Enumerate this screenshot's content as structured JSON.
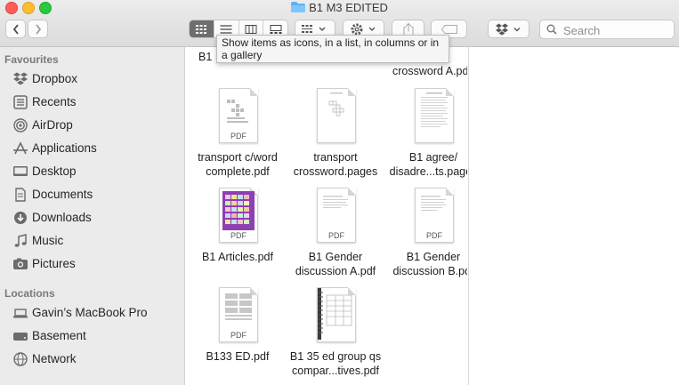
{
  "window": {
    "title": "B1 M3 EDITED",
    "tooltip": "Show items as icons, in a list, in columns or in a gallery"
  },
  "toolbar": {
    "back_icon": "chevron-left-icon",
    "forward_icon": "chevron-right-icon",
    "view_modes": [
      "icons",
      "list",
      "columns",
      "gallery"
    ],
    "selected_view": "icons",
    "search_placeholder": "Search"
  },
  "sidebar": {
    "favourites_heading": "Favourites",
    "favourites": [
      {
        "label": "Dropbox",
        "icon": "dropbox-icon"
      },
      {
        "label": "Recents",
        "icon": "recents-icon"
      },
      {
        "label": "AirDrop",
        "icon": "airdrop-icon"
      },
      {
        "label": "Applications",
        "icon": "applications-icon"
      },
      {
        "label": "Desktop",
        "icon": "desktop-icon"
      },
      {
        "label": "Documents",
        "icon": "documents-icon"
      },
      {
        "label": "Downloads",
        "icon": "downloads-icon"
      },
      {
        "label": "Music",
        "icon": "music-icon"
      },
      {
        "label": "Pictures",
        "icon": "pictures-icon"
      }
    ],
    "locations_heading": "Locations",
    "locations": [
      {
        "label": "Gavin’s MacBook Pro",
        "icon": "laptop-icon"
      },
      {
        "label": "Basement",
        "icon": "drive-icon"
      },
      {
        "label": "Network",
        "icon": "network-icon"
      }
    ]
  },
  "files": {
    "partial_top": [
      {
        "line1": "B1 ",
        "line2": ""
      },
      {
        "line1": "rt",
        "line2": "crossword A.pdf"
      }
    ],
    "items": [
      {
        "line1": "transport c/word",
        "line2": "complete.pdf",
        "tag": "PDF"
      },
      {
        "line1": "transport",
        "line2": "crossword.pages",
        "tag": ""
      },
      {
        "line1": "B1 agree/",
        "line2": "disadre...ts.pages",
        "tag": ""
      },
      {
        "line1": "B1 Articles.pdf",
        "line2": "",
        "tag": "PDF"
      },
      {
        "line1": "B1 Gender",
        "line2": "discussion A.pdf",
        "tag": "PDF"
      },
      {
        "line1": "B1 Gender",
        "line2": "discussion B.pdf",
        "tag": "PDF"
      },
      {
        "line1": "B133 ED.pdf",
        "line2": "",
        "tag": "PDF"
      },
      {
        "line1": "B1 35 ed group qs",
        "line2": "compar...tives.pdf",
        "tag": ""
      }
    ]
  }
}
